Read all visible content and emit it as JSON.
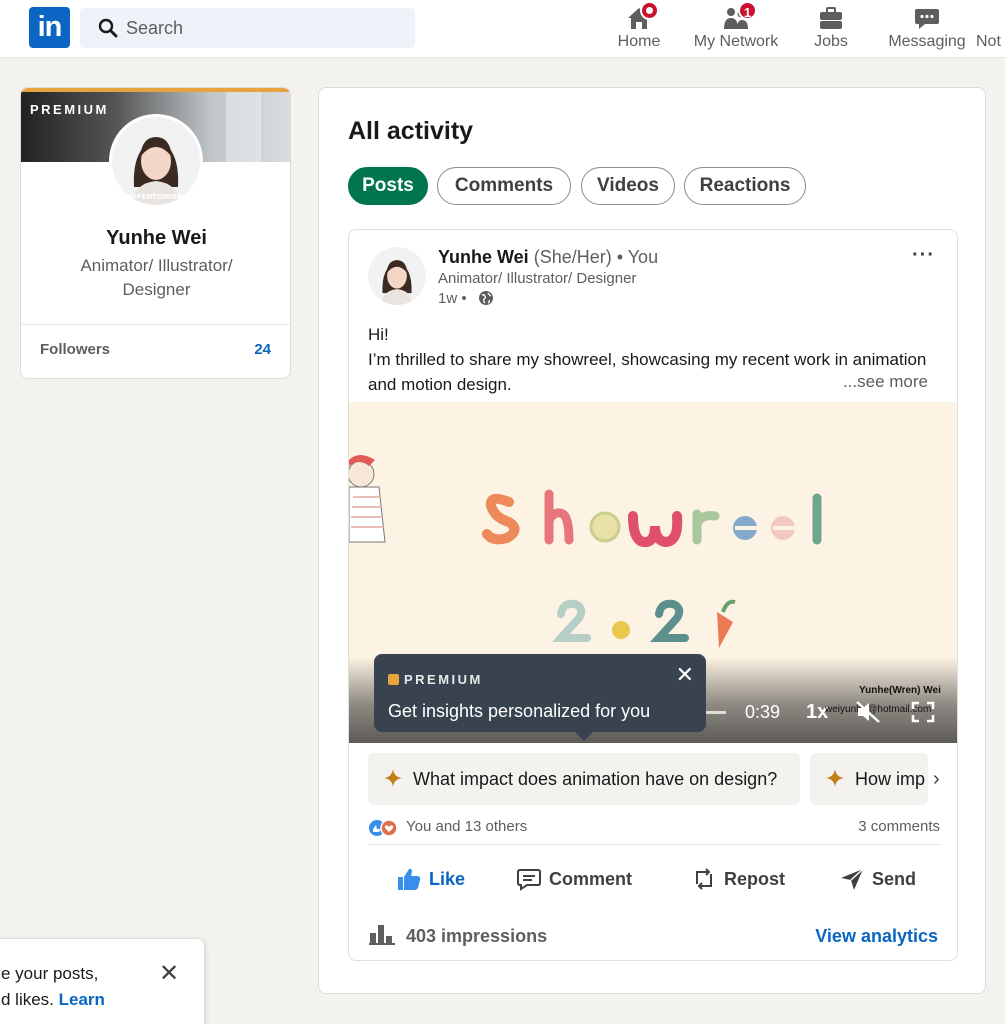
{
  "nav": {
    "logo": "in",
    "search_placeholder": "Search",
    "items": [
      {
        "label": "Home",
        "icon": "home-icon",
        "badge": ""
      },
      {
        "label": "My Network",
        "icon": "network-icon",
        "badge": "1"
      },
      {
        "label": "Jobs",
        "icon": "briefcase-icon",
        "badge": ""
      },
      {
        "label": "Messaging",
        "icon": "messaging-icon",
        "badge": ""
      },
      {
        "label": "Not",
        "icon": "bell-icon",
        "badge": ""
      }
    ]
  },
  "profile": {
    "premium_label": "PREMIUM",
    "name": "Yunhe Wei",
    "headline": "Animator/ Illustrator/ Designer",
    "followers_label": "Followers",
    "followers_count": "24"
  },
  "activity": {
    "title": "All activity",
    "tabs": [
      {
        "label": "Posts",
        "active": true
      },
      {
        "label": "Comments",
        "active": false
      },
      {
        "label": "Videos",
        "active": false
      },
      {
        "label": "Reactions",
        "active": false
      }
    ]
  },
  "post": {
    "author_name": "Yunhe Wei",
    "author_pronouns": "(She/Her) • You",
    "author_headline": "Animator/ Illustrator/ Designer",
    "time": "1w •",
    "text_line1": "Hi!",
    "text_line2": "I’m thrilled to share my showreel, showcasing my recent work in animation and motion design.",
    "see_more": "...see more",
    "video": {
      "title_text": "Showreel",
      "year_text": "2024",
      "time": "0:39",
      "speed": "1x",
      "watermark_name": "Yunhe(Wren) Wei",
      "watermark_email": "weiyunhe@hotmail.com"
    },
    "tooltip": {
      "label": "PREMIUM",
      "text": "Get insights personalized for you",
      "close": "✕"
    },
    "prompts": [
      "What impact does animation have on design?",
      "How imp"
    ],
    "reactions_text": "You and 13 others",
    "comments_text": "3 comments",
    "actions": [
      "Like",
      "Comment",
      "Repost",
      "Send"
    ],
    "impressions": "403 impressions",
    "analytics_link": "View analytics"
  },
  "toast": {
    "line1": "e your posts,",
    "line2_prefix": "d likes. ",
    "line2_link": "Learn",
    "close": "✕"
  },
  "colors": {
    "brand": "#0a66c2",
    "active_tab": "#01754f",
    "badge": "#cb112d",
    "background": "#f4f2ee"
  }
}
